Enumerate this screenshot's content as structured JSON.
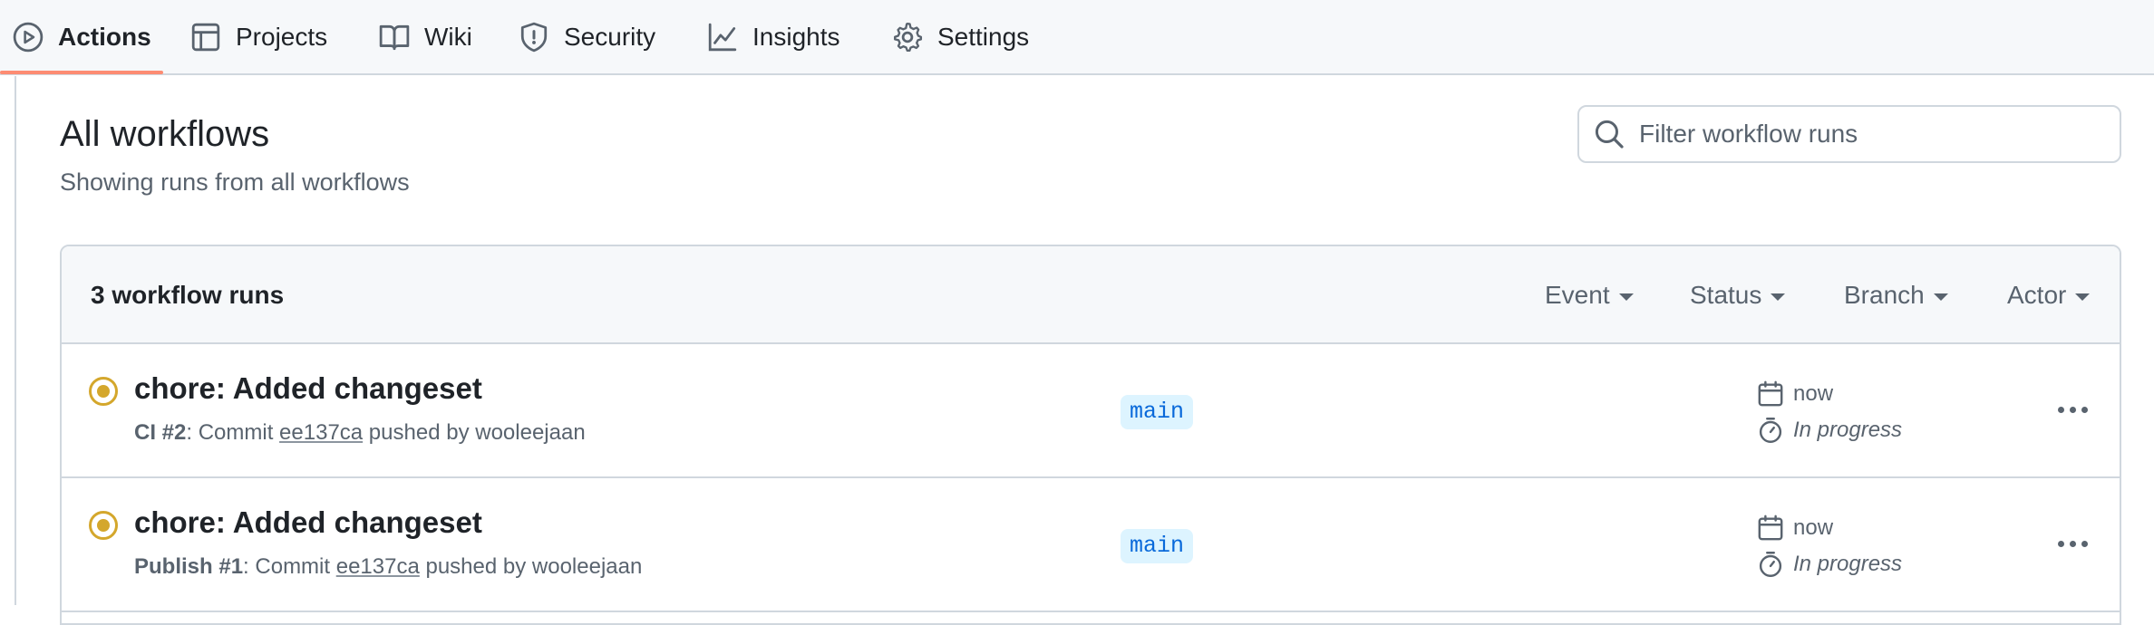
{
  "nav": {
    "tabs": [
      {
        "label": "Actions",
        "icon": "play-icon"
      },
      {
        "label": "Projects",
        "icon": "table-icon"
      },
      {
        "label": "Wiki",
        "icon": "book-icon"
      },
      {
        "label": "Security",
        "icon": "shield-icon"
      },
      {
        "label": "Insights",
        "icon": "graph-icon"
      },
      {
        "label": "Settings",
        "icon": "gear-icon"
      }
    ],
    "active_tab": "Actions",
    "accent_color": "#fd8c73"
  },
  "header": {
    "title": "All workflows",
    "subtitle": "Showing runs from all workflows"
  },
  "search": {
    "placeholder": "Filter workflow runs",
    "value": ""
  },
  "runs": {
    "count_label": "3 workflow runs",
    "filters": [
      "Event",
      "Status",
      "Branch",
      "Actor"
    ],
    "items": [
      {
        "title": "chore: Added changeset",
        "workflow": "CI #2",
        "meta_prefix": ": Commit ",
        "sha": "ee137ca",
        "meta_suffix": " pushed by wooleejaan",
        "branch": "main",
        "time": "now",
        "duration": "In progress",
        "status": "in-progress",
        "status_color": "#d4a72c"
      },
      {
        "title": "chore: Added changeset",
        "workflow": "Publish #1",
        "meta_prefix": ": Commit ",
        "sha": "ee137ca",
        "meta_suffix": " pushed by wooleejaan",
        "branch": "main",
        "time": "now",
        "duration": "In progress",
        "status": "in-progress",
        "status_color": "#d4a72c"
      }
    ]
  }
}
